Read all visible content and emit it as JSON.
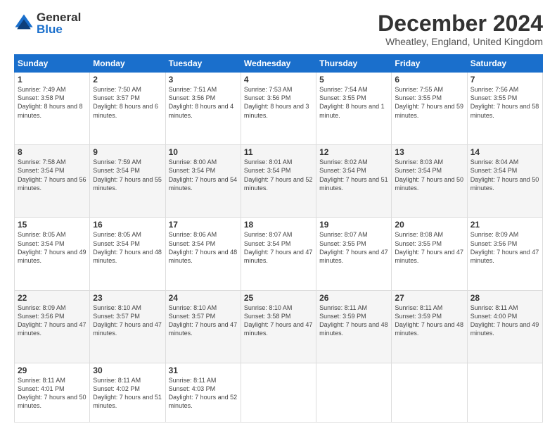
{
  "logo": {
    "general": "General",
    "blue": "Blue"
  },
  "title": "December 2024",
  "location": "Wheatley, England, United Kingdom",
  "days": [
    "Sunday",
    "Monday",
    "Tuesday",
    "Wednesday",
    "Thursday",
    "Friday",
    "Saturday"
  ],
  "weeks": [
    [
      {
        "num": "1",
        "sunrise": "7:49 AM",
        "sunset": "3:58 PM",
        "daylight": "8 hours and 8 minutes."
      },
      {
        "num": "2",
        "sunrise": "7:50 AM",
        "sunset": "3:57 PM",
        "daylight": "8 hours and 6 minutes."
      },
      {
        "num": "3",
        "sunrise": "7:51 AM",
        "sunset": "3:56 PM",
        "daylight": "8 hours and 4 minutes."
      },
      {
        "num": "4",
        "sunrise": "7:53 AM",
        "sunset": "3:56 PM",
        "daylight": "8 hours and 3 minutes."
      },
      {
        "num": "5",
        "sunrise": "7:54 AM",
        "sunset": "3:55 PM",
        "daylight": "8 hours and 1 minute."
      },
      {
        "num": "6",
        "sunrise": "7:55 AM",
        "sunset": "3:55 PM",
        "daylight": "7 hours and 59 minutes."
      },
      {
        "num": "7",
        "sunrise": "7:56 AM",
        "sunset": "3:55 PM",
        "daylight": "7 hours and 58 minutes."
      }
    ],
    [
      {
        "num": "8",
        "sunrise": "7:58 AM",
        "sunset": "3:54 PM",
        "daylight": "7 hours and 56 minutes."
      },
      {
        "num": "9",
        "sunrise": "7:59 AM",
        "sunset": "3:54 PM",
        "daylight": "7 hours and 55 minutes."
      },
      {
        "num": "10",
        "sunrise": "8:00 AM",
        "sunset": "3:54 PM",
        "daylight": "7 hours and 54 minutes."
      },
      {
        "num": "11",
        "sunrise": "8:01 AM",
        "sunset": "3:54 PM",
        "daylight": "7 hours and 52 minutes."
      },
      {
        "num": "12",
        "sunrise": "8:02 AM",
        "sunset": "3:54 PM",
        "daylight": "7 hours and 51 minutes."
      },
      {
        "num": "13",
        "sunrise": "8:03 AM",
        "sunset": "3:54 PM",
        "daylight": "7 hours and 50 minutes."
      },
      {
        "num": "14",
        "sunrise": "8:04 AM",
        "sunset": "3:54 PM",
        "daylight": "7 hours and 50 minutes."
      }
    ],
    [
      {
        "num": "15",
        "sunrise": "8:05 AM",
        "sunset": "3:54 PM",
        "daylight": "7 hours and 49 minutes."
      },
      {
        "num": "16",
        "sunrise": "8:05 AM",
        "sunset": "3:54 PM",
        "daylight": "7 hours and 48 minutes."
      },
      {
        "num": "17",
        "sunrise": "8:06 AM",
        "sunset": "3:54 PM",
        "daylight": "7 hours and 48 minutes."
      },
      {
        "num": "18",
        "sunrise": "8:07 AM",
        "sunset": "3:54 PM",
        "daylight": "7 hours and 47 minutes."
      },
      {
        "num": "19",
        "sunrise": "8:07 AM",
        "sunset": "3:55 PM",
        "daylight": "7 hours and 47 minutes."
      },
      {
        "num": "20",
        "sunrise": "8:08 AM",
        "sunset": "3:55 PM",
        "daylight": "7 hours and 47 minutes."
      },
      {
        "num": "21",
        "sunrise": "8:09 AM",
        "sunset": "3:56 PM",
        "daylight": "7 hours and 47 minutes."
      }
    ],
    [
      {
        "num": "22",
        "sunrise": "8:09 AM",
        "sunset": "3:56 PM",
        "daylight": "7 hours and 47 minutes."
      },
      {
        "num": "23",
        "sunrise": "8:10 AM",
        "sunset": "3:57 PM",
        "daylight": "7 hours and 47 minutes."
      },
      {
        "num": "24",
        "sunrise": "8:10 AM",
        "sunset": "3:57 PM",
        "daylight": "7 hours and 47 minutes."
      },
      {
        "num": "25",
        "sunrise": "8:10 AM",
        "sunset": "3:58 PM",
        "daylight": "7 hours and 47 minutes."
      },
      {
        "num": "26",
        "sunrise": "8:11 AM",
        "sunset": "3:59 PM",
        "daylight": "7 hours and 48 minutes."
      },
      {
        "num": "27",
        "sunrise": "8:11 AM",
        "sunset": "3:59 PM",
        "daylight": "7 hours and 48 minutes."
      },
      {
        "num": "28",
        "sunrise": "8:11 AM",
        "sunset": "4:00 PM",
        "daylight": "7 hours and 49 minutes."
      }
    ],
    [
      {
        "num": "29",
        "sunrise": "8:11 AM",
        "sunset": "4:01 PM",
        "daylight": "7 hours and 50 minutes."
      },
      {
        "num": "30",
        "sunrise": "8:11 AM",
        "sunset": "4:02 PM",
        "daylight": "7 hours and 51 minutes."
      },
      {
        "num": "31",
        "sunrise": "8:11 AM",
        "sunset": "4:03 PM",
        "daylight": "7 hours and 52 minutes."
      },
      null,
      null,
      null,
      null
    ]
  ]
}
